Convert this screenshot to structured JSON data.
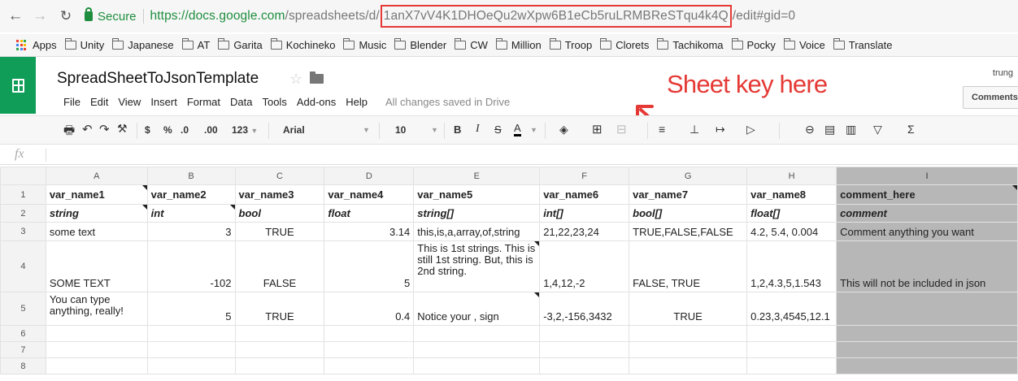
{
  "browser": {
    "back_icon": "back-arrow-icon",
    "forward_icon": "forward-arrow-icon",
    "reload_icon": "reload-icon",
    "secure_label": "Secure",
    "url": {
      "host": "https://docs.google.com",
      "path": "/spreadsheets/d/",
      "key": "1anX7vV4K1DHOeQu2wXpw6B1eCb5ruLRMBReSTqu4k4Q",
      "suffix": "/edit#gid=0"
    },
    "key_box_color": "#e53935"
  },
  "bookmarks": [
    {
      "label": "Apps",
      "icon": "apps-grid-icon"
    },
    {
      "label": "Unity",
      "icon": "folder-icon"
    },
    {
      "label": "Japanese",
      "icon": "folder-icon"
    },
    {
      "label": "AT",
      "icon": "folder-icon"
    },
    {
      "label": "Garita",
      "icon": "folder-icon"
    },
    {
      "label": "Kochineko",
      "icon": "folder-icon"
    },
    {
      "label": "Music",
      "icon": "folder-icon"
    },
    {
      "label": "Blender",
      "icon": "folder-icon"
    },
    {
      "label": "CW",
      "icon": "folder-icon"
    },
    {
      "label": "Million",
      "icon": "folder-icon"
    },
    {
      "label": "Troop",
      "icon": "folder-icon"
    },
    {
      "label": "Clorets",
      "icon": "folder-icon"
    },
    {
      "label": "Tachikoma",
      "icon": "folder-icon"
    },
    {
      "label": "Pocky",
      "icon": "folder-icon"
    },
    {
      "label": "Voice",
      "icon": "folder-icon"
    },
    {
      "label": "Translate",
      "icon": "folder-icon"
    }
  ],
  "doc": {
    "title": "SpreadSheetToJsonTemplate",
    "menu": [
      "File",
      "Edit",
      "View",
      "Insert",
      "Format",
      "Data",
      "Tools",
      "Add-ons",
      "Help"
    ],
    "save_status": "All changes saved in Drive",
    "user": "trung",
    "comments_label": "Comments",
    "brand_color": "#0f9d58"
  },
  "annotation": {
    "text": "Sheet key here",
    "color": "#e53935"
  },
  "toolbar": {
    "currency": "$",
    "percent": "%",
    "decrease_decimals": ".0",
    "increase_decimals": ".00",
    "more_formats": "123",
    "font": "Arial",
    "font_size": "10",
    "bold": "B",
    "italic": "I",
    "strike": "S",
    "text_color": "A",
    "sigma": "Σ"
  },
  "formula_bar": {
    "fx_label": "fx",
    "value": ""
  },
  "sheet": {
    "columns": [
      "A",
      "B",
      "C",
      "D",
      "E",
      "F",
      "G",
      "H",
      "I"
    ],
    "rows": [
      {
        "n": "1",
        "cells": [
          "var_name1",
          "var_name2",
          "var_name3",
          "var_name4",
          "var_name5",
          "var_name6",
          "var_name7",
          "var_name8",
          "comment_here"
        ]
      },
      {
        "n": "2",
        "cells": [
          "string",
          "int",
          "bool",
          "float",
          "string[]",
          "int[]",
          "bool[]",
          "float[]",
          "comment"
        ]
      },
      {
        "n": "3",
        "cells": [
          "some text",
          "3",
          "TRUE",
          "3.14",
          "this,is,a,array,of,string",
          "21,22,23,24",
          "TRUE,FALSE,FALSE",
          "4.2, 5.4, 0.004",
          "Comment anything you want"
        ]
      },
      {
        "n": "4",
        "cells": [
          "SOME TEXT",
          "-102",
          "FALSE",
          "5",
          "This is 1st strings. This is still 1st string. But, this is 2nd string.",
          "1,4,12,-2",
          "FALSE, TRUE",
          "1,2,4.3,5,1.543",
          "This will not be included in json"
        ]
      },
      {
        "n": "5",
        "cells": [
          "You can type anything, really!",
          "5",
          "TRUE",
          "0.4",
          "Notice your , sign",
          "-3,2,-156,3432",
          "TRUE",
          "0.23,3,4545,12.1",
          ""
        ]
      },
      {
        "n": "6",
        "cells": [
          "",
          "",
          "",
          "",
          "",
          "",
          "",
          "",
          ""
        ]
      },
      {
        "n": "7",
        "cells": [
          "",
          "",
          "",
          "",
          "",
          "",
          "",
          "",
          ""
        ]
      },
      {
        "n": "8",
        "cells": [
          "",
          "",
          "",
          "",
          "",
          "",
          "",
          "",
          ""
        ]
      }
    ],
    "comment_column_color": "#b7b7b7"
  }
}
